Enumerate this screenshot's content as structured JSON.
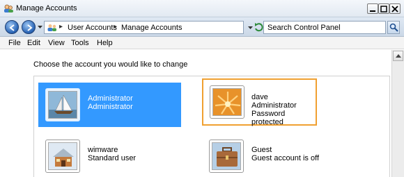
{
  "window": {
    "title": "Manage Accounts"
  },
  "address_bar": {
    "crumbs": [
      "User Accounts",
      "Manage Accounts"
    ],
    "search_placeholder": "Search Control Panel"
  },
  "menu": [
    "File",
    "Edit",
    "View",
    "Tools",
    "Help"
  ],
  "content": {
    "prompt": "Choose the account you would like to change",
    "accounts": [
      {
        "name": "Administrator",
        "lines": [
          "Administrator"
        ],
        "picture": "sailboat-picture",
        "state": "selected"
      },
      {
        "name": "dave",
        "lines": [
          "Administrator",
          "Password protected"
        ],
        "picture": "flower-picture",
        "state": "focused"
      },
      {
        "name": "wimware",
        "lines": [
          "Standard user"
        ],
        "picture": "cabin-picture",
        "state": "normal"
      },
      {
        "name": "Guest",
        "lines": [
          "Guest account is off"
        ],
        "picture": "briefcase-picture",
        "state": "normal"
      }
    ]
  },
  "colors": {
    "selection": "#3399ff",
    "focus_border": "#f0a030",
    "toolbar": "#cbd8e7"
  }
}
